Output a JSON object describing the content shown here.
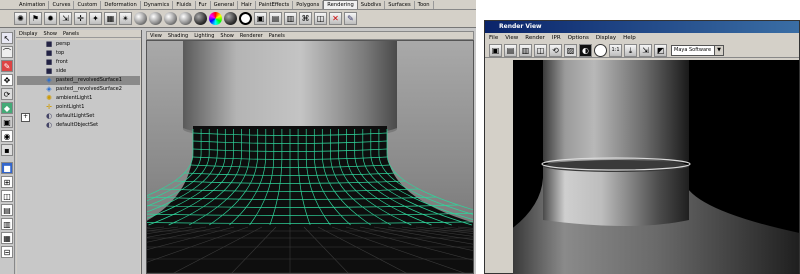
{
  "maya": {
    "shelf_tabs": [
      "Animation",
      "Curves",
      "Custom",
      "Deformation",
      "Dynamics",
      "Fluids",
      "Fur",
      "General",
      "Hair",
      "PaintEffects",
      "Polygons",
      "Rendering",
      "Subdivs",
      "Surfaces",
      "Toon"
    ],
    "active_tab": "Rendering",
    "outliner": {
      "menu": [
        "Display",
        "Show",
        "Panels"
      ],
      "items": [
        {
          "label": "persp",
          "icon": "camera-icon",
          "selected": false,
          "expandable": false
        },
        {
          "label": "top",
          "icon": "camera-icon",
          "selected": false,
          "expandable": false
        },
        {
          "label": "front",
          "icon": "camera-icon",
          "selected": false,
          "expandable": false
        },
        {
          "label": "side",
          "icon": "camera-icon",
          "selected": false,
          "expandable": false
        },
        {
          "label": "pasted__revolvedSurface1",
          "icon": "nurbs-surface-icon",
          "selected": true,
          "expandable": false
        },
        {
          "label": "pasted__revolvedSurface2",
          "icon": "nurbs-surface-icon",
          "selected": false,
          "expandable": false
        },
        {
          "label": "ambientLight1",
          "icon": "ambient-light-icon",
          "selected": false,
          "expandable": false
        },
        {
          "label": "pointLight1",
          "icon": "point-light-icon",
          "selected": false,
          "expandable": false
        },
        {
          "label": "defaultLightSet",
          "icon": "set-icon",
          "selected": false,
          "expandable": true
        },
        {
          "label": "defaultObjectSet",
          "icon": "set-icon",
          "selected": false,
          "expandable": false
        }
      ]
    },
    "viewport": {
      "menu": [
        "View",
        "Shading",
        "Lighting",
        "Show",
        "Renderer",
        "Panels"
      ]
    }
  },
  "render_view": {
    "title": "Render View",
    "menu": [
      "File",
      "View",
      "Render",
      "IPR",
      "Options",
      "Display",
      "Help"
    ],
    "ratio_label": "1:1",
    "renderer": "Maya Software"
  }
}
